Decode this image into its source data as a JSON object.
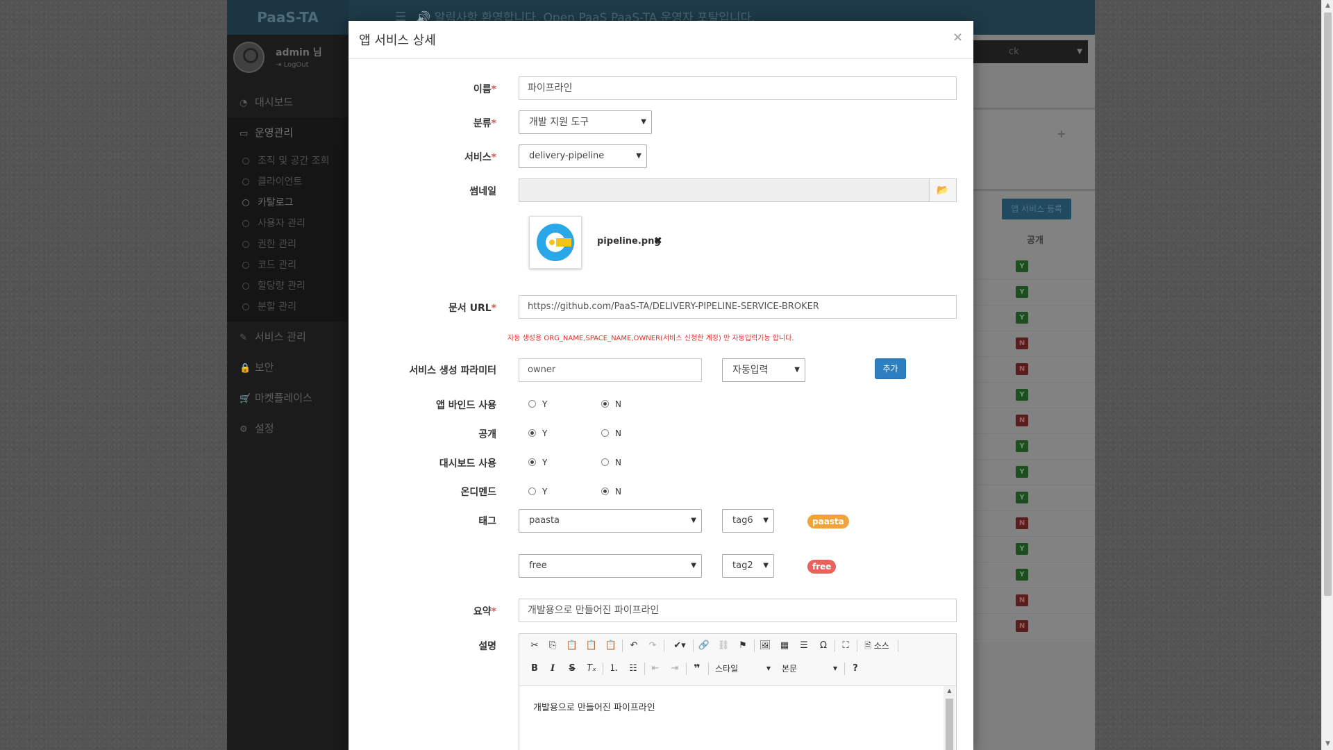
{
  "background": {
    "brand": "PaaS-TA",
    "notice": "알림사항 환영합니다. Open PaaS PaaS-TA 운영자 포탈입니다.",
    "top_select": "ck",
    "user": {
      "name": "admin 님",
      "logout": "LogOut"
    },
    "menu": {
      "dashboard": "대시보드",
      "operations": "운영관리",
      "sub_items": [
        "조직 및 공간 조회",
        "클라이언트",
        "카탈로그",
        "사용자 관리",
        "권한 관리",
        "코드 관리",
        "할당량 관리",
        "분할 관리"
      ],
      "service_mgmt": "서비스 관리",
      "security": "보안",
      "marketplace": "마켓플레이스",
      "settings": "설정"
    },
    "register_button": "앱 서비스 등록",
    "column_public": "공개",
    "public_flags": [
      "Y",
      "Y",
      "Y",
      "N",
      "N",
      "Y",
      "N",
      "Y",
      "Y",
      "Y",
      "N",
      "Y",
      "Y",
      "N",
      "N"
    ]
  },
  "modal": {
    "title": "앱 서비스 상세",
    "close": "×",
    "labels": {
      "name": "이름",
      "category": "분류",
      "service": "서비스",
      "thumbnail": "썸네일",
      "doc_url": "문서 URL",
      "params": "서비스 생성 파라미터",
      "app_bind": "앱 바인드 사용",
      "public": "공개",
      "dashboard": "대시보드 사용",
      "on_demand": "온디멘드",
      "tags": "태그",
      "summary": "요약",
      "description": "설명"
    },
    "required_mark": "*",
    "name_value": "파이프라인",
    "category_value": "개발 지원 도구",
    "service_value": "delivery-pipeline",
    "thumbnail_file": "pipeline.png",
    "doc_url_value": "https://github.com/PaaS-TA/DELIVERY-PIPELINE-SERVICE-BROKER",
    "warning": "자동 생성용 ORG_NAME,SPACE_NAME,OWNER(서비스 신청한 계정) 만 자동입력가능 합니다.",
    "param_value": "owner",
    "param_mode": "자동입력",
    "add_button": "추가",
    "radio_y": "Y",
    "radio_n": "N",
    "radios": {
      "app_bind": "N",
      "public": "Y",
      "dashboard": "Y",
      "on_demand": "N"
    },
    "tags": [
      {
        "value": "paasta",
        "color": "tag6",
        "pill": "paasta",
        "pill_color": "#f0a23b"
      },
      {
        "value": "free",
        "color": "tag2",
        "pill": "free",
        "pill_color": "#e9625c"
      }
    ],
    "summary_value": "개발용으로 만들어진 파이프라인",
    "editor": {
      "source_label": "소스",
      "style_combo": "스타일",
      "format_combo": "본문",
      "help": "?",
      "content": "개발용으로 만들어진 파이프라인"
    }
  }
}
